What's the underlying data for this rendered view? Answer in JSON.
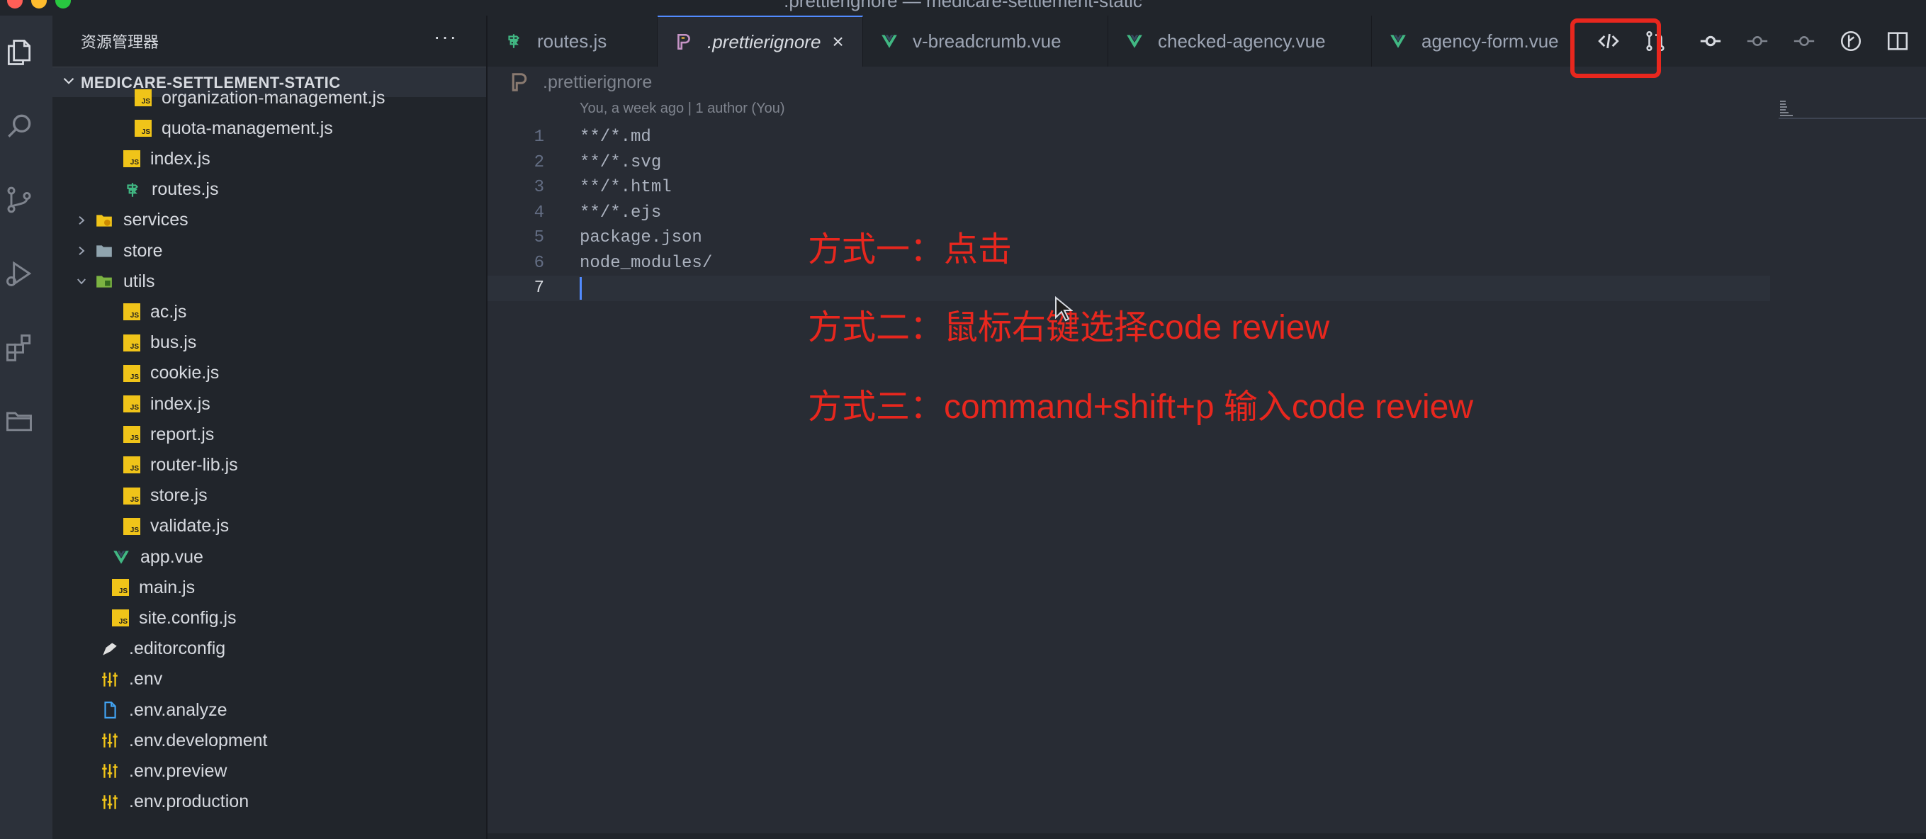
{
  "window": {
    "title": ".prettierignore — medicare-settlement-static"
  },
  "activity_bar": {
    "icons": [
      "explorer-icon",
      "search-icon",
      "source-control-icon",
      "run-debug-icon",
      "extensions-icon",
      "folder-icon"
    ]
  },
  "sidebar": {
    "header": "资源管理器",
    "more": "···",
    "section": "MEDICARE-SETTLEMENT-STATIC",
    "items": [
      {
        "label": "organization-management.js",
        "icon": "js"
      },
      {
        "label": "quota-management.js",
        "icon": "js"
      },
      {
        "label": "index.js",
        "icon": "js"
      },
      {
        "label": "routes.js",
        "icon": "routes"
      },
      {
        "label": "services",
        "icon": "folder-services"
      },
      {
        "label": "store",
        "icon": "folder"
      },
      {
        "label": "utils",
        "icon": "folder-utils"
      },
      {
        "label": "ac.js",
        "icon": "js"
      },
      {
        "label": "bus.js",
        "icon": "js"
      },
      {
        "label": "cookie.js",
        "icon": "js"
      },
      {
        "label": "index.js",
        "icon": "js"
      },
      {
        "label": "report.js",
        "icon": "js"
      },
      {
        "label": "router-lib.js",
        "icon": "js"
      },
      {
        "label": "store.js",
        "icon": "js"
      },
      {
        "label": "validate.js",
        "icon": "js"
      },
      {
        "label": "app.vue",
        "icon": "vue"
      },
      {
        "label": "main.js",
        "icon": "js"
      },
      {
        "label": "site.config.js",
        "icon": "js"
      },
      {
        "label": ".editorconfig",
        "icon": "editorconfig"
      },
      {
        "label": ".env",
        "icon": "env"
      },
      {
        "label": ".env.analyze",
        "icon": "file"
      },
      {
        "label": ".env.development",
        "icon": "env"
      },
      {
        "label": ".env.preview",
        "icon": "env"
      },
      {
        "label": ".env.production",
        "icon": "env"
      }
    ]
  },
  "tabs": [
    {
      "label": "routes.js",
      "icon": "routes"
    },
    {
      "label": ".prettierignore",
      "icon": "prettier",
      "active": true,
      "close": "×"
    },
    {
      "label": "v-breadcrumb.vue",
      "icon": "vue"
    },
    {
      "label": "checked-agency.vue",
      "icon": "vue"
    },
    {
      "label": "agency-form.vue",
      "icon": "vue"
    }
  ],
  "toolbar": {
    "icons": [
      "code-review-icon",
      "pull-request-icon",
      "git-commit-icon",
      "git-commit-prev-icon",
      "git-commit-next-icon",
      "git-graph-icon",
      "split-editor-icon"
    ]
  },
  "breadcrumb": {
    "file": ".prettierignore"
  },
  "editor": {
    "blame": "You, a week ago | 1 author (You)",
    "lines": [
      "**/*.md",
      "**/*.svg",
      "**/*.html",
      "**/*.ejs",
      "package.json",
      "node_modules/",
      ""
    ],
    "line_numbers": [
      "1",
      "2",
      "3",
      "4",
      "5",
      "6",
      "7"
    ],
    "current_line": 7
  },
  "annotations": [
    "方式一：点击",
    "方式二：鼠标右键选择code review",
    "方式三：command+shift+p 输入code review"
  ],
  "colors": {
    "annotation": "#e8271e",
    "accent": "#528bff",
    "js": "#f0c419",
    "vue": "#41b883"
  }
}
